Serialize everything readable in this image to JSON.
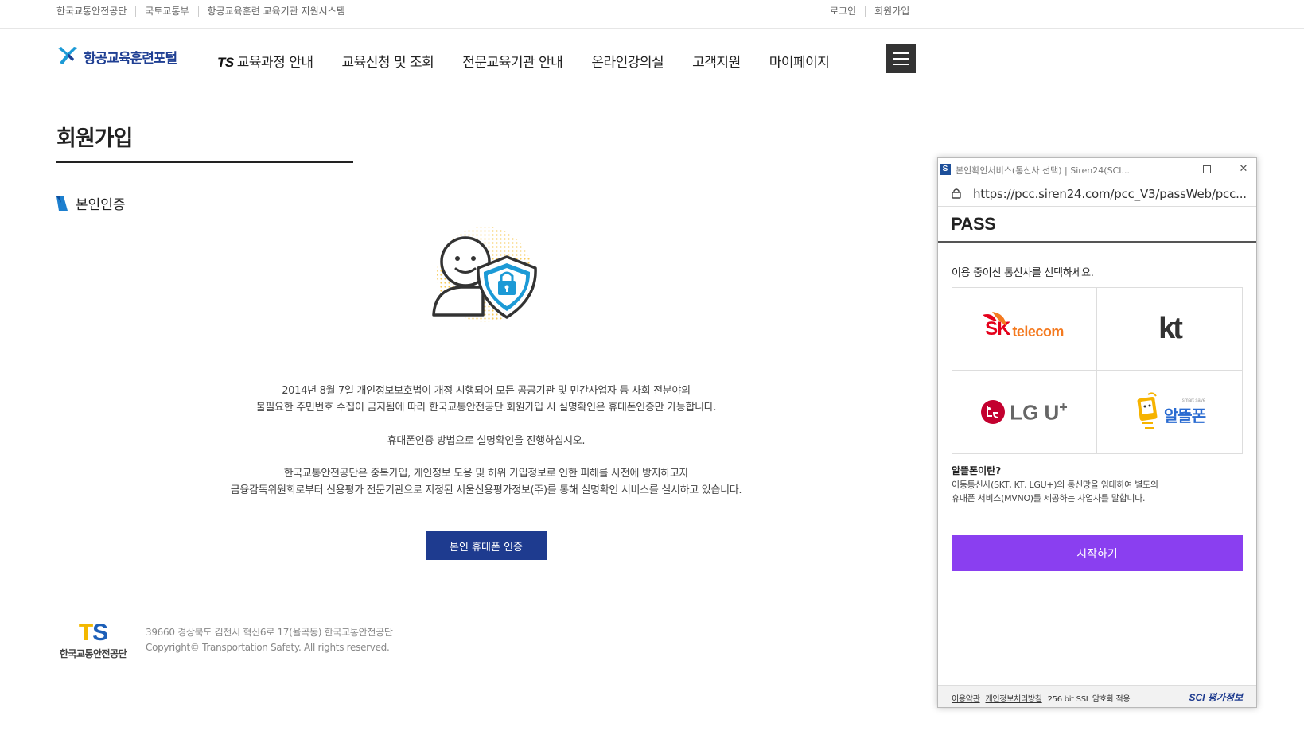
{
  "util": {
    "left": [
      "한국교통안전공단",
      "국토교통부",
      "항공교육훈련 교육기관 지원시스템"
    ],
    "right": [
      "로그인",
      "회원가입"
    ]
  },
  "header": {
    "logo_text": "항공교육훈련포털",
    "ts_mark": "TS",
    "nav": [
      "교육과정 안내",
      "교육신청 및 조회",
      "전문교육기관 안내",
      "온라인강의실",
      "고객지원",
      "마이페이지"
    ]
  },
  "page": {
    "title": "회원가입",
    "subtitle": "본인인증",
    "desc1_line1": "2014년 8월 7일 개인정보보호법이 개정 시행되어 모든 공공기관 및 민간사업자 등 사회 전분야의",
    "desc1_line2": "불필요한 주민번호 수집이 금지됨에 따라 한국교통안전공단 회원가입 시 실명확인은 휴대폰인증만 가능합니다.",
    "desc2": "휴대폰인증 방법으로 실명확인을 진행하십시오.",
    "desc3_line1": "한국교통안전공단은 중복가입, 개인정보 도용 및 허위 가입정보로 인한 피해를 사전에 방지하고자",
    "desc3_line2": "금융감독위원회로부터 신용평가 전문기관으로 지정된 서울신용평가정보(주)를 통해 실명확인 서비스를 실시하고 있습니다.",
    "auth_button": "본인 휴대폰 인증"
  },
  "footer": {
    "logo_ts_t": "T",
    "logo_ts_s": "S",
    "logo_name": "한국교통안전공단",
    "address": "39660 경상북도 김천시 혁신6로 17(율곡동) 한국교통안전공단",
    "copyright": "Copyright© Transportation Safety. All rights reserved."
  },
  "popup": {
    "window_title": "본인확인서비스(통신사 선택) | Siren24(SCI...",
    "url": "https://pcc.siren24.com/pcc_V3/passWeb/pcc...",
    "brand": "PASS",
    "prompt": "이용 중이신 통신사를 선택하세요.",
    "carriers": {
      "sk_main": "SK",
      "sk_sub": "telecom",
      "kt": "kt",
      "lg": "LG U",
      "lg_plus": "+",
      "altel": "알뜰폰",
      "altel_small": "smart save"
    },
    "mvno_question": "알뜰폰이란?",
    "mvno_answer_line1": "이동통신사(SKT, KT, LGU+)의 통신망을 임대하여 별도의",
    "mvno_answer_line2": "휴대폰 서비스(MVNO)를 제공하는 사업자를 말합니다.",
    "start_button": "시작하기",
    "footer_terms": "이용약관",
    "footer_privacy": "개인정보처리방침",
    "footer_ssl": "256 bit SSL 암호화 적용",
    "footer_brand": "SCI 평가정보"
  },
  "colors": {
    "primary_navy": "#1e3b8f",
    "pass_purple": "#8a3ff0",
    "sk_red": "#e4001b",
    "sk_orange": "#f47a20",
    "lg_red": "#c3002f",
    "accent_blue": "#1c9ad6"
  }
}
